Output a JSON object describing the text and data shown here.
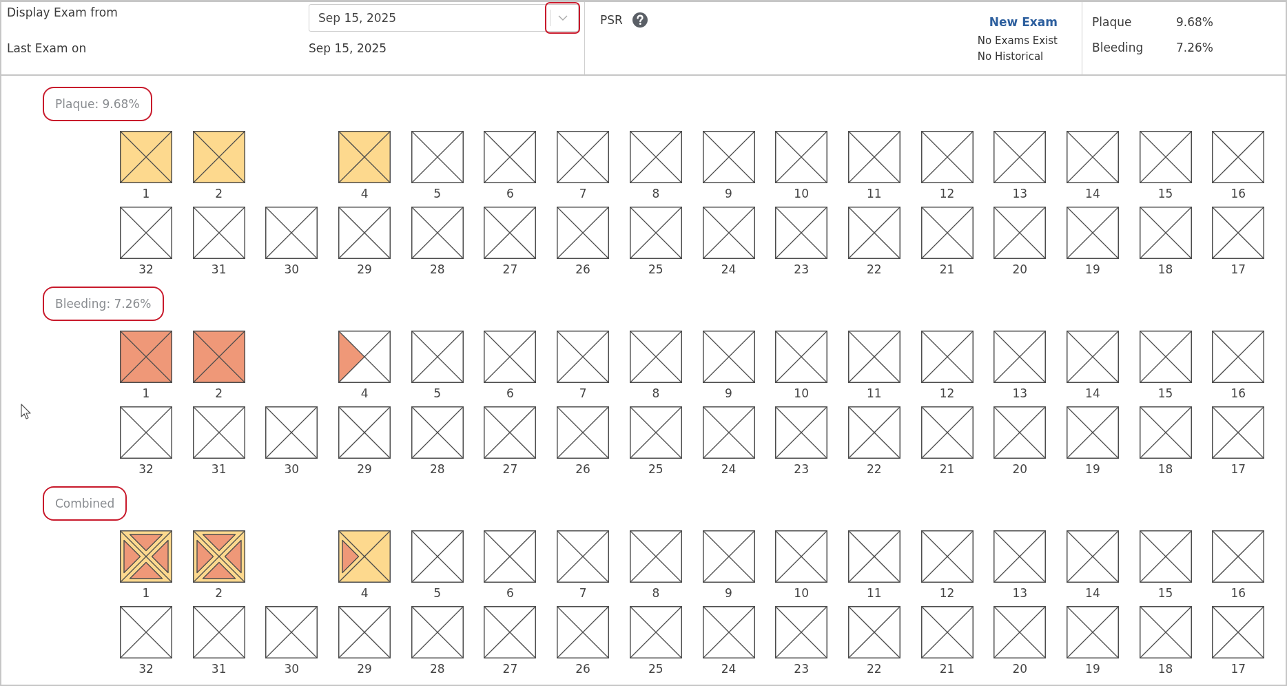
{
  "header": {
    "display_exam": {
      "label": "Display Exam from",
      "value": "Sep 15, 2025",
      "highlighted": true
    },
    "last_exam": {
      "label": "Last Exam on",
      "value": "Sep 15, 2025"
    },
    "psr": {
      "label": "PSR"
    },
    "new_exam_link": "New Exam",
    "exam_notes": [
      "No Exams Exist",
      "No Historical"
    ],
    "summary": [
      {
        "label": "Plaque",
        "value": "9.68%"
      },
      {
        "label": "Bleeding",
        "value": "7.26%"
      }
    ]
  },
  "sections": [
    {
      "label": "Plaque: 9.68%",
      "highlighted": true,
      "upper_teeth": [
        {
          "number": "1",
          "missing": false,
          "plaque": [
            true,
            true,
            true,
            true
          ]
        },
        {
          "number": "2",
          "missing": false,
          "plaque": [
            true,
            true,
            true,
            true
          ]
        },
        {
          "missing": true
        },
        {
          "number": "4",
          "missing": false,
          "plaque": [
            true,
            true,
            true,
            true
          ]
        },
        {
          "number": "5",
          "missing": false,
          "plaque": [
            false,
            false,
            false,
            false
          ]
        },
        {
          "number": "6",
          "missing": false,
          "plaque": [
            false,
            false,
            false,
            false
          ]
        },
        {
          "number": "7",
          "missing": false,
          "plaque": [
            false,
            false,
            false,
            false
          ]
        },
        {
          "number": "8",
          "missing": false,
          "plaque": [
            false,
            false,
            false,
            false
          ]
        },
        {
          "number": "9",
          "missing": false,
          "plaque": [
            false,
            false,
            false,
            false
          ]
        },
        {
          "number": "10",
          "missing": false,
          "plaque": [
            false,
            false,
            false,
            false
          ]
        },
        {
          "number": "11",
          "missing": false,
          "plaque": [
            false,
            false,
            false,
            false
          ]
        },
        {
          "number": "12",
          "missing": false,
          "plaque": [
            false,
            false,
            false,
            false
          ]
        },
        {
          "number": "13",
          "missing": false,
          "plaque": [
            false,
            false,
            false,
            false
          ]
        },
        {
          "number": "14",
          "missing": false,
          "plaque": [
            false,
            false,
            false,
            false
          ]
        },
        {
          "number": "15",
          "missing": false,
          "plaque": [
            false,
            false,
            false,
            false
          ]
        },
        {
          "number": "16",
          "missing": false,
          "plaque": [
            false,
            false,
            false,
            false
          ]
        }
      ],
      "lower_teeth": [
        {
          "number": "32",
          "missing": false,
          "plaque": [
            false,
            false,
            false,
            false
          ]
        },
        {
          "number": "31",
          "missing": false,
          "plaque": [
            false,
            false,
            false,
            false
          ]
        },
        {
          "number": "30",
          "missing": false,
          "plaque": [
            false,
            false,
            false,
            false
          ]
        },
        {
          "number": "29",
          "missing": false,
          "plaque": [
            false,
            false,
            false,
            false
          ]
        },
        {
          "number": "28",
          "missing": false,
          "plaque": [
            false,
            false,
            false,
            false
          ]
        },
        {
          "number": "27",
          "missing": false,
          "plaque": [
            false,
            false,
            false,
            false
          ]
        },
        {
          "number": "26",
          "missing": false,
          "plaque": [
            false,
            false,
            false,
            false
          ]
        },
        {
          "number": "25",
          "missing": false,
          "plaque": [
            false,
            false,
            false,
            false
          ]
        },
        {
          "number": "24",
          "missing": false,
          "plaque": [
            false,
            false,
            false,
            false
          ]
        },
        {
          "number": "23",
          "missing": false,
          "plaque": [
            false,
            false,
            false,
            false
          ]
        },
        {
          "number": "22",
          "missing": false,
          "plaque": [
            false,
            false,
            false,
            false
          ]
        },
        {
          "number": "21",
          "missing": false,
          "plaque": [
            false,
            false,
            false,
            false
          ]
        },
        {
          "number": "20",
          "missing": false,
          "plaque": [
            false,
            false,
            false,
            false
          ]
        },
        {
          "number": "19",
          "missing": false,
          "plaque": [
            false,
            false,
            false,
            false
          ]
        },
        {
          "number": "18",
          "missing": false,
          "plaque": [
            false,
            false,
            false,
            false
          ]
        },
        {
          "number": "17",
          "missing": false,
          "plaque": [
            false,
            false,
            false,
            false
          ]
        }
      ]
    },
    {
      "label": "Bleeding: 7.26%",
      "highlighted": true,
      "upper_teeth": [
        {
          "number": "1",
          "missing": false,
          "bleeding": [
            true,
            true,
            true,
            true
          ]
        },
        {
          "number": "2",
          "missing": false,
          "bleeding": [
            true,
            true,
            true,
            true
          ]
        },
        {
          "missing": true
        },
        {
          "number": "4",
          "missing": false,
          "bleeding": [
            false,
            false,
            false,
            true
          ]
        },
        {
          "number": "5",
          "missing": false,
          "bleeding": [
            false,
            false,
            false,
            false
          ]
        },
        {
          "number": "6",
          "missing": false,
          "bleeding": [
            false,
            false,
            false,
            false
          ]
        },
        {
          "number": "7",
          "missing": false,
          "bleeding": [
            false,
            false,
            false,
            false
          ]
        },
        {
          "number": "8",
          "missing": false,
          "bleeding": [
            false,
            false,
            false,
            false
          ]
        },
        {
          "number": "9",
          "missing": false,
          "bleeding": [
            false,
            false,
            false,
            false
          ]
        },
        {
          "number": "10",
          "missing": false,
          "bleeding": [
            false,
            false,
            false,
            false
          ]
        },
        {
          "number": "11",
          "missing": false,
          "bleeding": [
            false,
            false,
            false,
            false
          ]
        },
        {
          "number": "12",
          "missing": false,
          "bleeding": [
            false,
            false,
            false,
            false
          ]
        },
        {
          "number": "13",
          "missing": false,
          "bleeding": [
            false,
            false,
            false,
            false
          ]
        },
        {
          "number": "14",
          "missing": false,
          "bleeding": [
            false,
            false,
            false,
            false
          ]
        },
        {
          "number": "15",
          "missing": false,
          "bleeding": [
            false,
            false,
            false,
            false
          ]
        },
        {
          "number": "16",
          "missing": false,
          "bleeding": [
            false,
            false,
            false,
            false
          ]
        }
      ],
      "lower_teeth": [
        {
          "number": "32",
          "missing": false,
          "bleeding": [
            false,
            false,
            false,
            false
          ]
        },
        {
          "number": "31",
          "missing": false,
          "bleeding": [
            false,
            false,
            false,
            false
          ]
        },
        {
          "number": "30",
          "missing": false,
          "bleeding": [
            false,
            false,
            false,
            false
          ]
        },
        {
          "number": "29",
          "missing": false,
          "bleeding": [
            false,
            false,
            false,
            false
          ]
        },
        {
          "number": "28",
          "missing": false,
          "bleeding": [
            false,
            false,
            false,
            false
          ]
        },
        {
          "number": "27",
          "missing": false,
          "bleeding": [
            false,
            false,
            false,
            false
          ]
        },
        {
          "number": "26",
          "missing": false,
          "bleeding": [
            false,
            false,
            false,
            false
          ]
        },
        {
          "number": "25",
          "missing": false,
          "bleeding": [
            false,
            false,
            false,
            false
          ]
        },
        {
          "number": "24",
          "missing": false,
          "bleeding": [
            false,
            false,
            false,
            false
          ]
        },
        {
          "number": "23",
          "missing": false,
          "bleeding": [
            false,
            false,
            false,
            false
          ]
        },
        {
          "number": "22",
          "missing": false,
          "bleeding": [
            false,
            false,
            false,
            false
          ]
        },
        {
          "number": "21",
          "missing": false,
          "bleeding": [
            false,
            false,
            false,
            false
          ]
        },
        {
          "number": "20",
          "missing": false,
          "bleeding": [
            false,
            false,
            false,
            false
          ]
        },
        {
          "number": "19",
          "missing": false,
          "bleeding": [
            false,
            false,
            false,
            false
          ]
        },
        {
          "number": "18",
          "missing": false,
          "bleeding": [
            false,
            false,
            false,
            false
          ]
        },
        {
          "number": "17",
          "missing": false,
          "bleeding": [
            false,
            false,
            false,
            false
          ]
        }
      ]
    },
    {
      "label": "Combined",
      "highlighted": true,
      "upper_teeth": [
        {
          "number": "1",
          "missing": false,
          "plaque": [
            true,
            true,
            true,
            true
          ],
          "bleeding": [
            true,
            true,
            true,
            true
          ]
        },
        {
          "number": "2",
          "missing": false,
          "plaque": [
            true,
            true,
            true,
            true
          ],
          "bleeding": [
            true,
            true,
            true,
            true
          ]
        },
        {
          "missing": true
        },
        {
          "number": "4",
          "missing": false,
          "plaque": [
            true,
            true,
            true,
            true
          ],
          "bleeding": [
            false,
            false,
            false,
            true
          ]
        },
        {
          "number": "5",
          "missing": false,
          "plaque": [
            false,
            false,
            false,
            false
          ],
          "bleeding": [
            false,
            false,
            false,
            false
          ]
        },
        {
          "number": "6",
          "missing": false,
          "plaque": [
            false,
            false,
            false,
            false
          ],
          "bleeding": [
            false,
            false,
            false,
            false
          ]
        },
        {
          "number": "7",
          "missing": false,
          "plaque": [
            false,
            false,
            false,
            false
          ],
          "bleeding": [
            false,
            false,
            false,
            false
          ]
        },
        {
          "number": "8",
          "missing": false,
          "plaque": [
            false,
            false,
            false,
            false
          ],
          "bleeding": [
            false,
            false,
            false,
            false
          ]
        },
        {
          "number": "9",
          "missing": false,
          "plaque": [
            false,
            false,
            false,
            false
          ],
          "bleeding": [
            false,
            false,
            false,
            false
          ]
        },
        {
          "number": "10",
          "missing": false,
          "plaque": [
            false,
            false,
            false,
            false
          ],
          "bleeding": [
            false,
            false,
            false,
            false
          ]
        },
        {
          "number": "11",
          "missing": false,
          "plaque": [
            false,
            false,
            false,
            false
          ],
          "bleeding": [
            false,
            false,
            false,
            false
          ]
        },
        {
          "number": "12",
          "missing": false,
          "plaque": [
            false,
            false,
            false,
            false
          ],
          "bleeding": [
            false,
            false,
            false,
            false
          ]
        },
        {
          "number": "13",
          "missing": false,
          "plaque": [
            false,
            false,
            false,
            false
          ],
          "bleeding": [
            false,
            false,
            false,
            false
          ]
        },
        {
          "number": "14",
          "missing": false,
          "plaque": [
            false,
            false,
            false,
            false
          ],
          "bleeding": [
            false,
            false,
            false,
            false
          ]
        },
        {
          "number": "15",
          "missing": false,
          "plaque": [
            false,
            false,
            false,
            false
          ],
          "bleeding": [
            false,
            false,
            false,
            false
          ]
        },
        {
          "number": "16",
          "missing": false,
          "plaque": [
            false,
            false,
            false,
            false
          ],
          "bleeding": [
            false,
            false,
            false,
            false
          ]
        }
      ],
      "lower_teeth": [
        {
          "number": "32",
          "missing": false,
          "plaque": [
            false,
            false,
            false,
            false
          ],
          "bleeding": [
            false,
            false,
            false,
            false
          ]
        },
        {
          "number": "31",
          "missing": false,
          "plaque": [
            false,
            false,
            false,
            false
          ],
          "bleeding": [
            false,
            false,
            false,
            false
          ]
        },
        {
          "number": "30",
          "missing": false,
          "plaque": [
            false,
            false,
            false,
            false
          ],
          "bleeding": [
            false,
            false,
            false,
            false
          ]
        },
        {
          "number": "29",
          "missing": false,
          "plaque": [
            false,
            false,
            false,
            false
          ],
          "bleeding": [
            false,
            false,
            false,
            false
          ]
        },
        {
          "number": "28",
          "missing": false,
          "plaque": [
            false,
            false,
            false,
            false
          ],
          "bleeding": [
            false,
            false,
            false,
            false
          ]
        },
        {
          "number": "27",
          "missing": false,
          "plaque": [
            false,
            false,
            false,
            false
          ],
          "bleeding": [
            false,
            false,
            false,
            false
          ]
        },
        {
          "number": "26",
          "missing": false,
          "plaque": [
            false,
            false,
            false,
            false
          ],
          "bleeding": [
            false,
            false,
            false,
            false
          ]
        },
        {
          "number": "25",
          "missing": false,
          "plaque": [
            false,
            false,
            false,
            false
          ],
          "bleeding": [
            false,
            false,
            false,
            false
          ]
        },
        {
          "number": "24",
          "missing": false,
          "plaque": [
            false,
            false,
            false,
            false
          ],
          "bleeding": [
            false,
            false,
            false,
            false
          ]
        },
        {
          "number": "23",
          "missing": false,
          "plaque": [
            false,
            false,
            false,
            false
          ],
          "bleeding": [
            false,
            false,
            false,
            false
          ]
        },
        {
          "number": "22",
          "missing": false,
          "plaque": [
            false,
            false,
            false,
            false
          ],
          "bleeding": [
            false,
            false,
            false,
            false
          ]
        },
        {
          "number": "21",
          "missing": false,
          "plaque": [
            false,
            false,
            false,
            false
          ],
          "bleeding": [
            false,
            false,
            false,
            false
          ]
        },
        {
          "number": "20",
          "missing": false,
          "plaque": [
            false,
            false,
            false,
            false
          ],
          "bleeding": [
            false,
            false,
            false,
            false
          ]
        },
        {
          "number": "19",
          "missing": false,
          "plaque": [
            false,
            false,
            false,
            false
          ],
          "bleeding": [
            false,
            false,
            false,
            false
          ]
        },
        {
          "number": "18",
          "missing": false,
          "plaque": [
            false,
            false,
            false,
            false
          ],
          "bleeding": [
            false,
            false,
            false,
            false
          ]
        },
        {
          "number": "17",
          "missing": false,
          "plaque": [
            false,
            false,
            false,
            false
          ],
          "bleeding": [
            false,
            false,
            false,
            false
          ]
        }
      ]
    }
  ]
}
